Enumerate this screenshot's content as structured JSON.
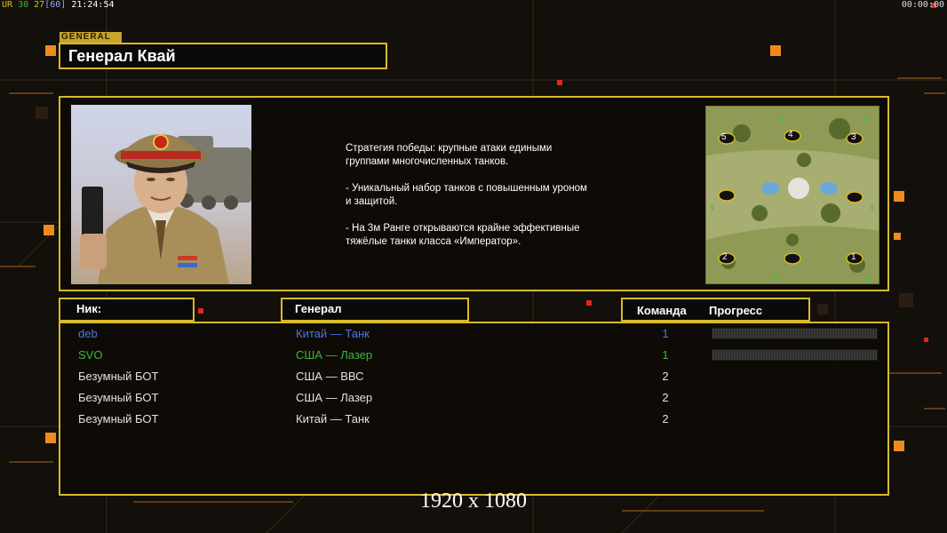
{
  "status": {
    "top_left": {
      "prefix": "UR",
      "a": "30",
      "b": "27",
      "c": "[60]",
      "time": "21:24:54"
    },
    "top_right": "00:00:00"
  },
  "general": {
    "section_label": "GENERAL",
    "name": "Генерал Квай",
    "description": [
      "Стратегия победы: крупные атаки едиными\n группами многочисленных танков.",
      "- Уникальный набор танков с повышенным уроном\n и защитой.",
      "- На 3м Ранге открываются крайне эффективные\n тяжёлые танки класса «Император»."
    ]
  },
  "minimap": {
    "starts": [
      "5",
      "4",
      "3",
      "2",
      "1"
    ]
  },
  "headers": {
    "nick": "Ник:",
    "general": "Генерал",
    "team": "Команда",
    "progress": "Прогресс"
  },
  "players": [
    {
      "nick": "deb",
      "general": "Китай — Танк",
      "team": "1",
      "color": "#4f74e3",
      "progress": true
    },
    {
      "nick": "SVO",
      "general": "США — Лазер",
      "team": "1",
      "color": "#3fb43c",
      "progress": true
    },
    {
      "nick": "Безумный БОТ",
      "general": "США — ВВС",
      "team": "2",
      "color": "#ffffff",
      "progress": false
    },
    {
      "nick": "Безумный БОТ",
      "general": "США — Лазер",
      "team": "2",
      "color": "#ffffff",
      "progress": false
    },
    {
      "nick": "Безумный БОТ",
      "general": "Китай — Танк",
      "team": "2",
      "color": "#ffffff",
      "progress": false
    }
  ],
  "resolution": "1920 x 1080",
  "colors": {
    "accent": "#d7ba2a",
    "orange": "#f08a1c"
  }
}
